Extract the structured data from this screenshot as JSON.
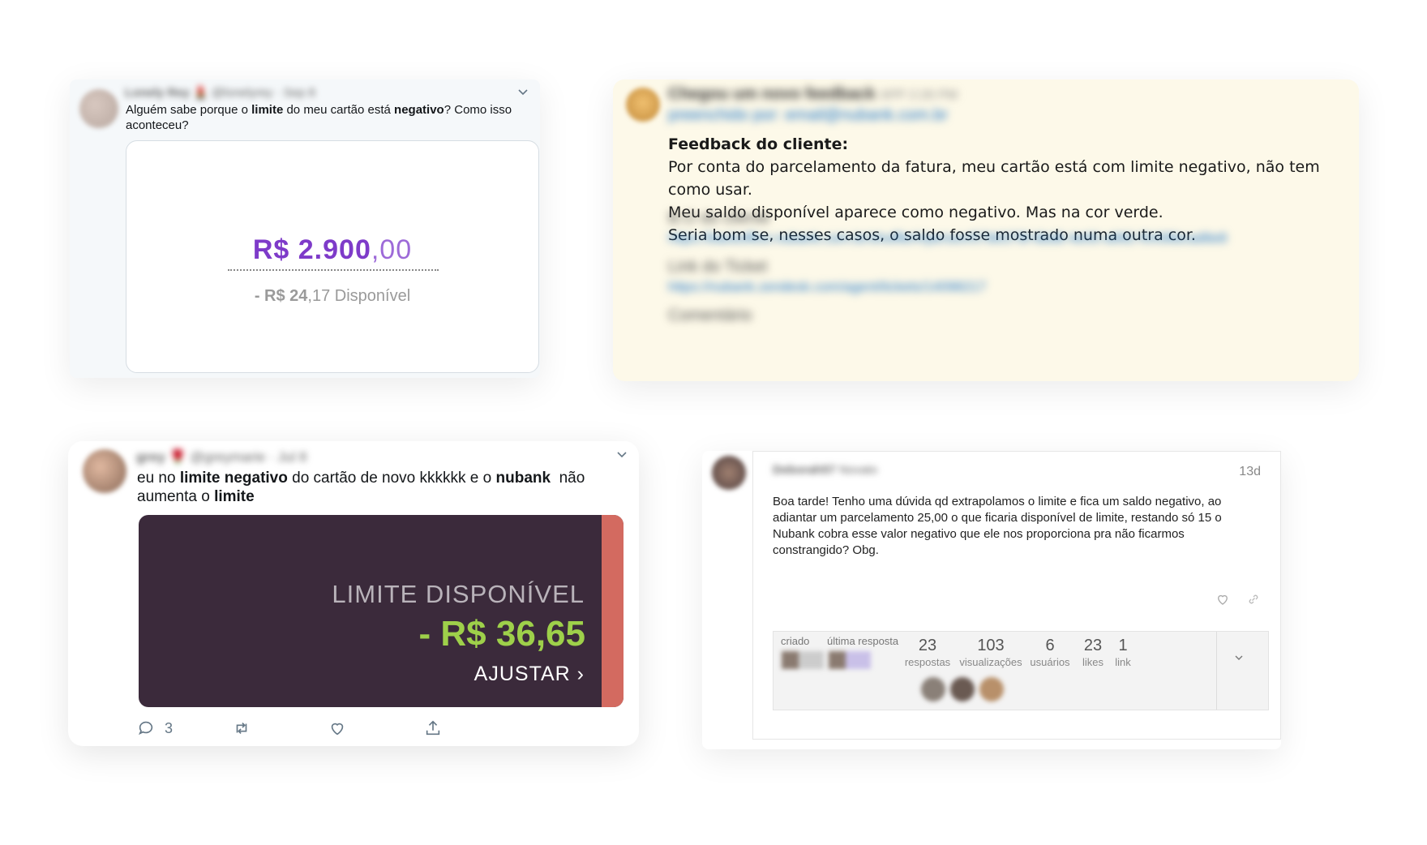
{
  "tweet1": {
    "author_blurred": "Lonely Rey 💄",
    "handle_blurred": "@lonelyrey · Sep 8",
    "text_html": "Alguém sabe porque o <b>limite</b> do meu cartão está <b>negativo</b>? Como isso aconteceu?",
    "amount_main": "R$ 2.900",
    "amount_cents": ",00",
    "available_bold": "- R$ 24",
    "available_rest": ",17 Disponível"
  },
  "feedback": {
    "header_blurred": "Chegou um novo feedback",
    "tag_blurred": "APP  2:26 PM",
    "sender_blurred": "preenchido por: email@nubank.com.br",
    "title": "Feedback do cliente:",
    "lines": [
      "Por conta do parcelamento da fatura, meu cartão está com limite negativo, não tem como usar.",
      "Meu saldo disponível aparece como negativo. Mas na cor verde.",
      "Seria bom se, nesses casos, o saldo fosse mostrado numa outra cor."
    ],
    "id_label_blurred": "B.O do cliente",
    "id_link_blurred": "https://backoffice.nubank.com.br/shuffle/#/person/57b6379f-6bd8-4e00-a992-f5436bcad6e8",
    "ticket_label_blurred": "Link do Ticket",
    "ticket_link_blurred": "https://nubank.zendesk.com/agent/tickets/14098217",
    "comment_blurred": "Comentário"
  },
  "tweet2": {
    "author_blurred": "grey 🌹",
    "handle_blurred": "@greymarie · Jul 8",
    "text_html": "eu no <b>limite negativo</b> do cartão de novo kkkkkk e o <b>nubank</b>&nbsp; não aumenta o <b>limite</b>",
    "card_label": "LIMITE DISPONÍVEL",
    "card_amount": "- R$ 36,65",
    "card_action": "AJUSTAR ›",
    "reply_count": "3"
  },
  "forum": {
    "author_blurred": "Deborah57",
    "badge_blurred": "Novato",
    "date": "13d",
    "text": "Boa tarde! Tenho uma dúvida qd extrapolamos o limite e fica um saldo negativo, ao adiantar um parcelamento 25,00 o que ficaria disponível de limite, restando só 15 o Nubank cobra esse valor negativo que ele nos proporciona pra não ficarmos constrangido? Obg.",
    "created_label": "criado",
    "last_reply_label": "última resposta",
    "stats": [
      {
        "num": "23",
        "label": "respostas"
      },
      {
        "num": "103",
        "label": "visualizações"
      },
      {
        "num": "6",
        "label": "usuários"
      },
      {
        "num": "23",
        "label": "likes"
      },
      {
        "num": "1",
        "label": "link"
      }
    ]
  },
  "colors": {
    "purple": "#7e3bc9",
    "green": "#9ed04a",
    "card_bg": "#3b2a3b",
    "stripe": "#d36a60",
    "feedback_bg": "#fdf9e9"
  }
}
